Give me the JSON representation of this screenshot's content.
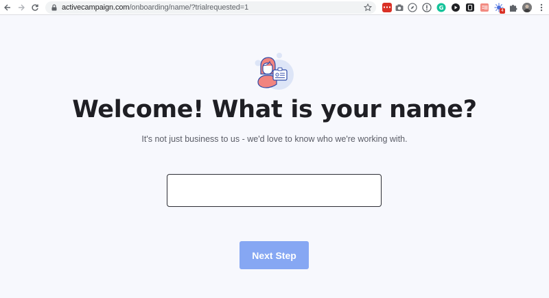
{
  "browser": {
    "url_domain": "activecampaign.com",
    "url_path": "/onboarding/name/?trialrequested=1",
    "extensions": [
      {
        "name": "ext-red-icon",
        "color": "#d93025"
      },
      {
        "name": "camera-icon",
        "color": "#5f6368"
      },
      {
        "name": "compass-icon",
        "color": "#5f6368"
      },
      {
        "name": "shield-icon",
        "color": "#5f6368"
      },
      {
        "name": "grammarly-icon",
        "color": "#15c39a"
      },
      {
        "name": "play-icon",
        "color": "#202124"
      },
      {
        "name": "ext-dark-icon",
        "color": "#202124"
      },
      {
        "name": "ext-pink-icon",
        "color": "#e8453c"
      },
      {
        "name": "sparkle-icon",
        "color": "#4a6fdc"
      },
      {
        "name": "puzzle-icon",
        "color": "#5f6368"
      },
      {
        "name": "avatar",
        "color": "#6b6b6b"
      },
      {
        "name": "menu-dots-icon",
        "color": "#5f6368"
      }
    ],
    "badge_count": "4"
  },
  "main": {
    "illustration": "profile-card-illustration",
    "title": "Welcome! What is your name?",
    "subtitle": "It's not just business to us - we'd love to know who we're working with.",
    "name_input": {
      "value": "",
      "placeholder": ""
    },
    "next_button_label": "Next Step"
  },
  "colors": {
    "background": "#f7f8fd",
    "button": "#86a7f3",
    "title": "#1f1f24"
  }
}
